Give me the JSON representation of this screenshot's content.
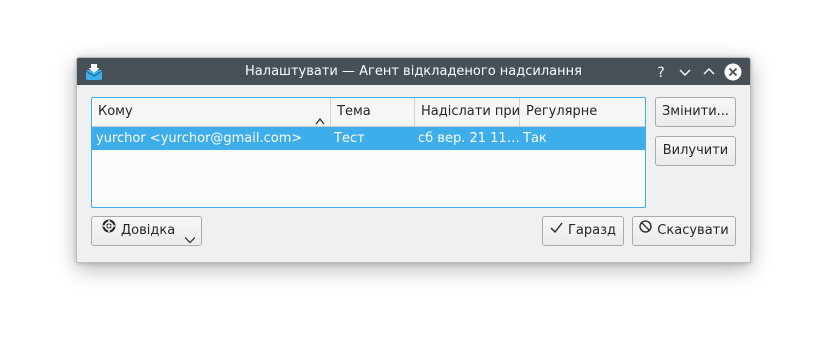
{
  "window": {
    "title": "Налаштувати — Агент відкладеного надсилання",
    "app_icon": "mail-send-later-icon",
    "controls": [
      "help-icon",
      "minimize-icon",
      "maximize-icon",
      "close-icon"
    ]
  },
  "table": {
    "headers": [
      "Кому",
      "Тема",
      "Надіслати при",
      "Регулярне"
    ],
    "sort_icon": "sort-ascending-icon",
    "rows": [
      {
        "to": "yurchor <yurchor@gmail.com>",
        "subject": "Тест",
        "send_at": "сб вер. 21 11…",
        "recurrent": "Так"
      }
    ]
  },
  "side_buttons": {
    "modify": "Змінити...",
    "delete": "Вилучити"
  },
  "footer": {
    "help": "Довідка",
    "ok": "Гаразд",
    "cancel": "Скасувати"
  },
  "colors": {
    "titlebar": "#475057",
    "selection": "#3daee9",
    "window_bg": "#eff0f1"
  }
}
